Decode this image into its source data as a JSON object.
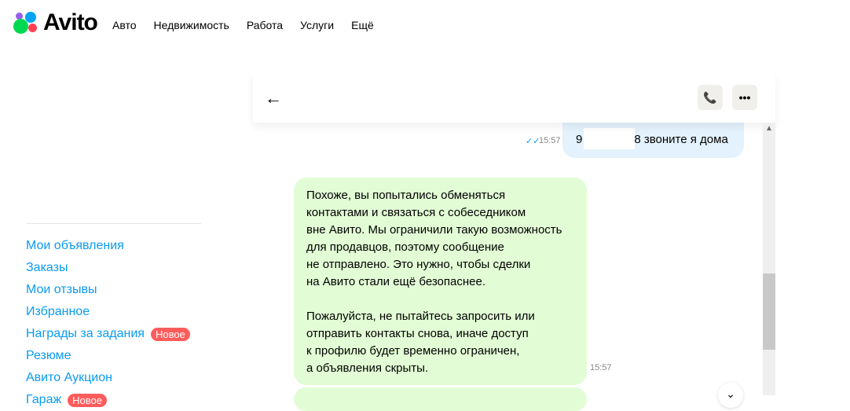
{
  "header": {
    "logo": "Avito",
    "nav": [
      "Авто",
      "Недвижимость",
      "Работа",
      "Услуги",
      "Ещё"
    ]
  },
  "sidebar": {
    "items": [
      {
        "label": "Мои объявления"
      },
      {
        "label": "Заказы"
      },
      {
        "label": "Мои отзывы"
      },
      {
        "label": "Избранное"
      },
      {
        "label": "Награды за задания",
        "badge": "Новое"
      },
      {
        "label": "Резюме"
      },
      {
        "label": "Авито Аукцион"
      },
      {
        "label": "Гараж",
        "badge": "Новое"
      }
    ]
  },
  "chat": {
    "outgoing": {
      "text_start": "9",
      "text_end": "8 звоните я дома",
      "time": "15:57",
      "status": "read"
    },
    "system": {
      "text": "Похоже, вы попытались обменяться\nконтактами и связаться с собеседником\nвне Авито. Мы ограничили такую возможность\nдля продавцов, поэтому сообщение\nне отправлено. Это нужно, чтобы сделки\nна Авито стали ещё безопаснее.\n\nПожалуйста, не пытайтесь запросить или\nотправить контакты снова, иначе доступ\nк профилю будет временно ограничен,\nа объявления скрыты.",
      "time": "15:57"
    }
  }
}
